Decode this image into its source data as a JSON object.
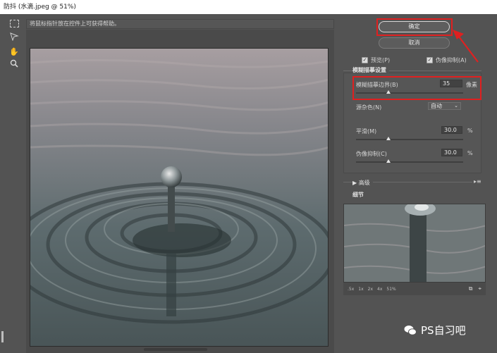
{
  "window": {
    "title": "防抖 (水滴.jpeg @ 51%)"
  },
  "hint_text": "将鼠标指针放在控件上可获得帮助。",
  "buttons": {
    "ok": "确定",
    "cancel": "取消"
  },
  "checkboxes": {
    "preview": {
      "label": "预览(P)",
      "checked": true
    },
    "defringe": {
      "label": "伪像抑制(A)",
      "checked": true
    }
  },
  "blur_section": {
    "title": "模糊描摹设置",
    "blur_trace_bounds": {
      "label": "模糊描摹边界(B)",
      "value": "35",
      "unit": "像素",
      "slider_fraction": 0.3
    },
    "source_noise": {
      "label": "源杂色(N)",
      "value": "自动"
    },
    "smoothing": {
      "label": "平滑(M)",
      "value": "30.0",
      "unit": "%",
      "slider_fraction": 0.3
    },
    "artifact_suppression": {
      "label": "伪像抑制(C)",
      "value": "30.0",
      "unit": "%",
      "slider_fraction": 0.3
    }
  },
  "advanced": {
    "label": "高级"
  },
  "detail": {
    "title": "细节",
    "zoom_levels": [
      ".5x",
      "1x",
      "2x",
      "4x",
      "51%"
    ]
  },
  "watermark": {
    "text": "PS自习吧"
  },
  "colors": {
    "highlight": "#e02020",
    "panel": "#535353",
    "water": "#5b6a6c"
  }
}
